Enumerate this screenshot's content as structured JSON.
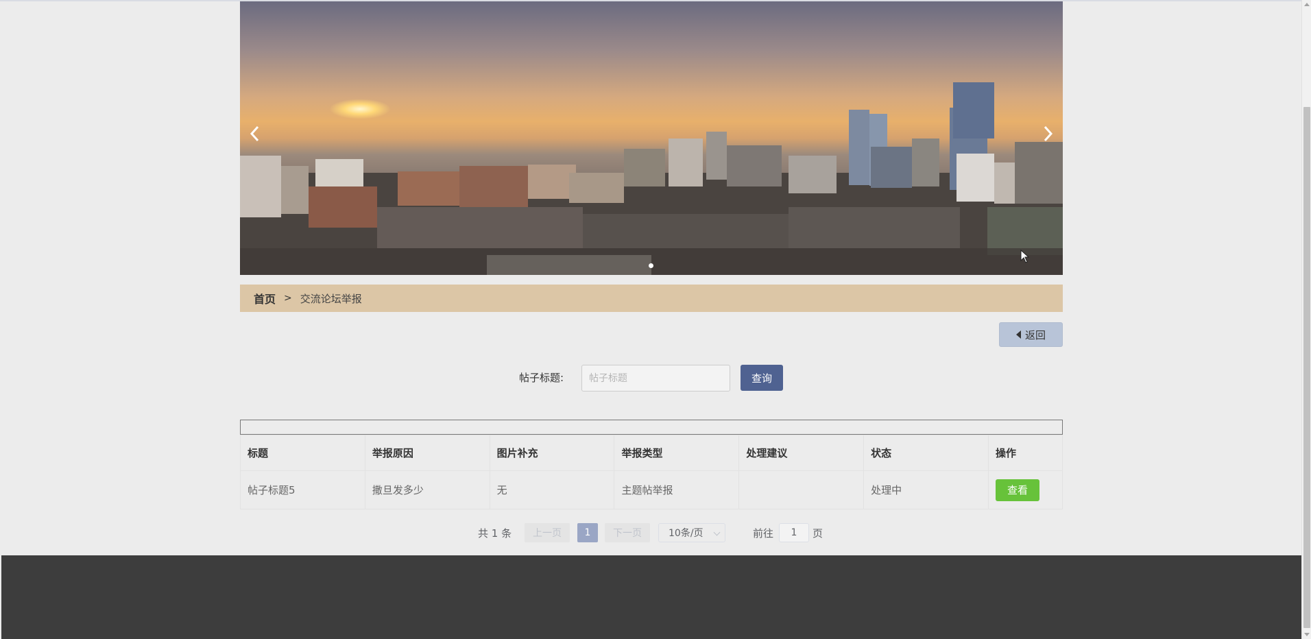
{
  "banner": {
    "prev_icon": "chevron-left-icon",
    "next_icon": "chevron-right-icon",
    "slide_count": 1,
    "active_slide": 1
  },
  "breadcrumb": {
    "home": "首页",
    "separator": ">",
    "current": "交流论坛举报"
  },
  "actions": {
    "back_label": "返回",
    "back_icon": "caret-left-icon"
  },
  "search": {
    "label": "帖子标题:",
    "placeholder": "帖子标题",
    "value": "",
    "button_label": "查询"
  },
  "table": {
    "columns": [
      "标题",
      "举报原因",
      "图片补充",
      "举报类型",
      "处理建议",
      "状态",
      "操作"
    ],
    "rows": [
      {
        "title": "帖子标题5",
        "reason": "撒旦发多少",
        "image_supplement": "无",
        "report_type": "主题帖举报",
        "suggestion": "",
        "status": "处理中",
        "action_label": "查看"
      }
    ]
  },
  "pagination": {
    "total_text": "共 1 条",
    "prev_label": "上一页",
    "current_page": "1",
    "next_label": "下一页",
    "page_size_label": "10条/页",
    "goto_label": "前往",
    "goto_value": "1",
    "page_suffix": "页"
  },
  "colors": {
    "breadcrumb_bg": "#dcc6a6",
    "search_button": "#4f6291",
    "view_button": "#67c23a",
    "back_button": "#b8c4d8",
    "footer": "#3d3d3d",
    "active_page": "#9aa6c5"
  }
}
